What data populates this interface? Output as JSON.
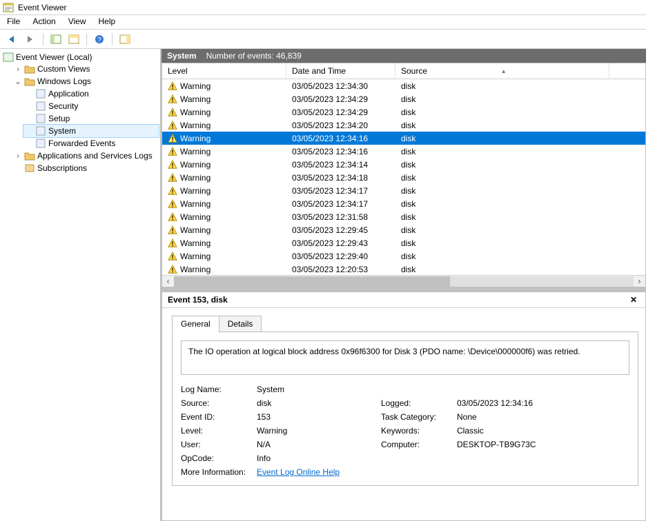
{
  "window": {
    "title": "Event Viewer"
  },
  "menu": {
    "file": "File",
    "action": "Action",
    "view": "View",
    "help": "Help"
  },
  "tree": {
    "root": "Event Viewer (Local)",
    "custom_views": "Custom Views",
    "windows_logs": "Windows Logs",
    "application": "Application",
    "security": "Security",
    "setup": "Setup",
    "system": "System",
    "forwarded": "Forwarded Events",
    "apps_services": "Applications and Services Logs",
    "subscriptions": "Subscriptions"
  },
  "list": {
    "header_log": "System",
    "header_count_label": "Number of events:",
    "header_count": "46,839",
    "cols": {
      "level": "Level",
      "date": "Date and Time",
      "source": "Source"
    },
    "rows": [
      {
        "level": "Warning",
        "date": "03/05/2023 12:34:30",
        "source": "disk",
        "sel": false
      },
      {
        "level": "Warning",
        "date": "03/05/2023 12:34:29",
        "source": "disk",
        "sel": false
      },
      {
        "level": "Warning",
        "date": "03/05/2023 12:34:29",
        "source": "disk",
        "sel": false
      },
      {
        "level": "Warning",
        "date": "03/05/2023 12:34:20",
        "source": "disk",
        "sel": false
      },
      {
        "level": "Warning",
        "date": "03/05/2023 12:34:16",
        "source": "disk",
        "sel": true
      },
      {
        "level": "Warning",
        "date": "03/05/2023 12:34:16",
        "source": "disk",
        "sel": false
      },
      {
        "level": "Warning",
        "date": "03/05/2023 12:34:14",
        "source": "disk",
        "sel": false
      },
      {
        "level": "Warning",
        "date": "03/05/2023 12:34:18",
        "source": "disk",
        "sel": false
      },
      {
        "level": "Warning",
        "date": "03/05/2023 12:34:17",
        "source": "disk",
        "sel": false
      },
      {
        "level": "Warning",
        "date": "03/05/2023 12:34:17",
        "source": "disk",
        "sel": false
      },
      {
        "level": "Warning",
        "date": "03/05/2023 12:31:58",
        "source": "disk",
        "sel": false
      },
      {
        "level": "Warning",
        "date": "03/05/2023 12:29:45",
        "source": "disk",
        "sel": false
      },
      {
        "level": "Warning",
        "date": "03/05/2023 12:29:43",
        "source": "disk",
        "sel": false
      },
      {
        "level": "Warning",
        "date": "03/05/2023 12:29:40",
        "source": "disk",
        "sel": false
      },
      {
        "level": "Warning",
        "date": "03/05/2023 12:20:53",
        "source": "disk",
        "sel": false
      }
    ]
  },
  "details": {
    "title": "Event 153, disk",
    "tabs": {
      "general": "General",
      "details": "Details"
    },
    "message": "The IO operation at logical block address 0x96f6300 for Disk 3 (PDO name: \\Device\\000000f6) was retried.",
    "labels": {
      "log_name": "Log Name:",
      "source": "Source:",
      "event_id": "Event ID:",
      "level": "Level:",
      "user": "User:",
      "opcode": "OpCode:",
      "more_info": "More Information:",
      "logged": "Logged:",
      "task": "Task Category:",
      "keywords": "Keywords:",
      "computer": "Computer:"
    },
    "values": {
      "log_name": "System",
      "source": "disk",
      "event_id": "153",
      "level": "Warning",
      "user": "N/A",
      "opcode": "Info",
      "more_info": "Event Log Online Help",
      "logged": "03/05/2023 12:34:16",
      "task": "None",
      "keywords": "Classic",
      "computer": "DESKTOP-TB9G73C"
    }
  }
}
